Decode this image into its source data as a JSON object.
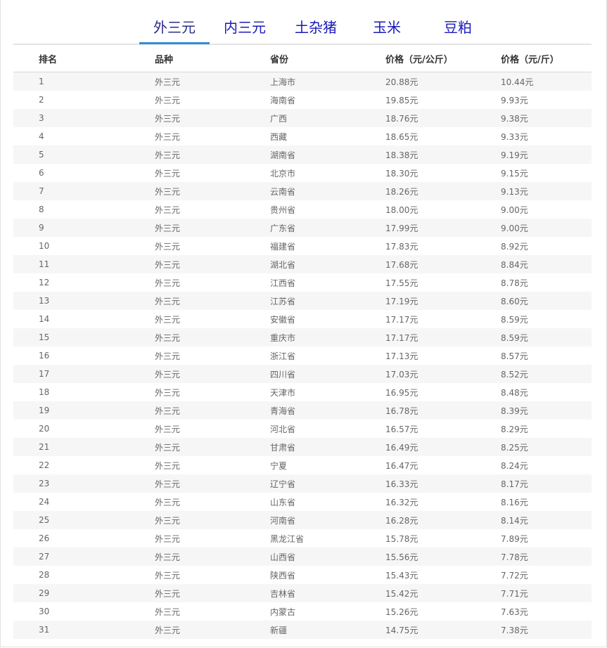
{
  "tabs": [
    {
      "label": "外三元",
      "active": true
    },
    {
      "label": "内三元",
      "active": false
    },
    {
      "label": "土杂猪",
      "active": false
    },
    {
      "label": "玉米",
      "active": false
    },
    {
      "label": "豆粕",
      "active": false
    }
  ],
  "table": {
    "headers": [
      "排名",
      "品种",
      "省份",
      "价格（元/公斤）",
      "价格（元/斤）"
    ],
    "rows": [
      [
        "1",
        "外三元",
        "上海市",
        "20.88元",
        "10.44元"
      ],
      [
        "2",
        "外三元",
        "海南省",
        "19.85元",
        "9.93元"
      ],
      [
        "3",
        "外三元",
        "广西",
        "18.76元",
        "9.38元"
      ],
      [
        "4",
        "外三元",
        "西藏",
        "18.65元",
        "9.33元"
      ],
      [
        "5",
        "外三元",
        "湖南省",
        "18.38元",
        "9.19元"
      ],
      [
        "6",
        "外三元",
        "北京市",
        "18.30元",
        "9.15元"
      ],
      [
        "7",
        "外三元",
        "云南省",
        "18.26元",
        "9.13元"
      ],
      [
        "8",
        "外三元",
        "贵州省",
        "18.00元",
        "9.00元"
      ],
      [
        "9",
        "外三元",
        "广东省",
        "17.99元",
        "9.00元"
      ],
      [
        "10",
        "外三元",
        "福建省",
        "17.83元",
        "8.92元"
      ],
      [
        "11",
        "外三元",
        "湖北省",
        "17.68元",
        "8.84元"
      ],
      [
        "12",
        "外三元",
        "江西省",
        "17.55元",
        "8.78元"
      ],
      [
        "13",
        "外三元",
        "江苏省",
        "17.19元",
        "8.60元"
      ],
      [
        "14",
        "外三元",
        "安徽省",
        "17.17元",
        "8.59元"
      ],
      [
        "15",
        "外三元",
        "重庆市",
        "17.17元",
        "8.59元"
      ],
      [
        "16",
        "外三元",
        "浙江省",
        "17.13元",
        "8.57元"
      ],
      [
        "17",
        "外三元",
        "四川省",
        "17.03元",
        "8.52元"
      ],
      [
        "18",
        "外三元",
        "天津市",
        "16.95元",
        "8.48元"
      ],
      [
        "19",
        "外三元",
        "青海省",
        "16.78元",
        "8.39元"
      ],
      [
        "20",
        "外三元",
        "河北省",
        "16.57元",
        "8.29元"
      ],
      [
        "21",
        "外三元",
        "甘肃省",
        "16.49元",
        "8.25元"
      ],
      [
        "22",
        "外三元",
        "宁夏",
        "16.47元",
        "8.24元"
      ],
      [
        "23",
        "外三元",
        "辽宁省",
        "16.33元",
        "8.17元"
      ],
      [
        "24",
        "外三元",
        "山东省",
        "16.32元",
        "8.16元"
      ],
      [
        "25",
        "外三元",
        "河南省",
        "16.28元",
        "8.14元"
      ],
      [
        "26",
        "外三元",
        "黑龙江省",
        "15.78元",
        "7.89元"
      ],
      [
        "27",
        "外三元",
        "山西省",
        "15.56元",
        "7.78元"
      ],
      [
        "28",
        "外三元",
        "陕西省",
        "15.43元",
        "7.72元"
      ],
      [
        "29",
        "外三元",
        "吉林省",
        "15.42元",
        "7.71元"
      ],
      [
        "30",
        "外三元",
        "内蒙古",
        "15.26元",
        "7.63元"
      ],
      [
        "31",
        "外三元",
        "新疆",
        "14.75元",
        "7.38元"
      ]
    ]
  }
}
